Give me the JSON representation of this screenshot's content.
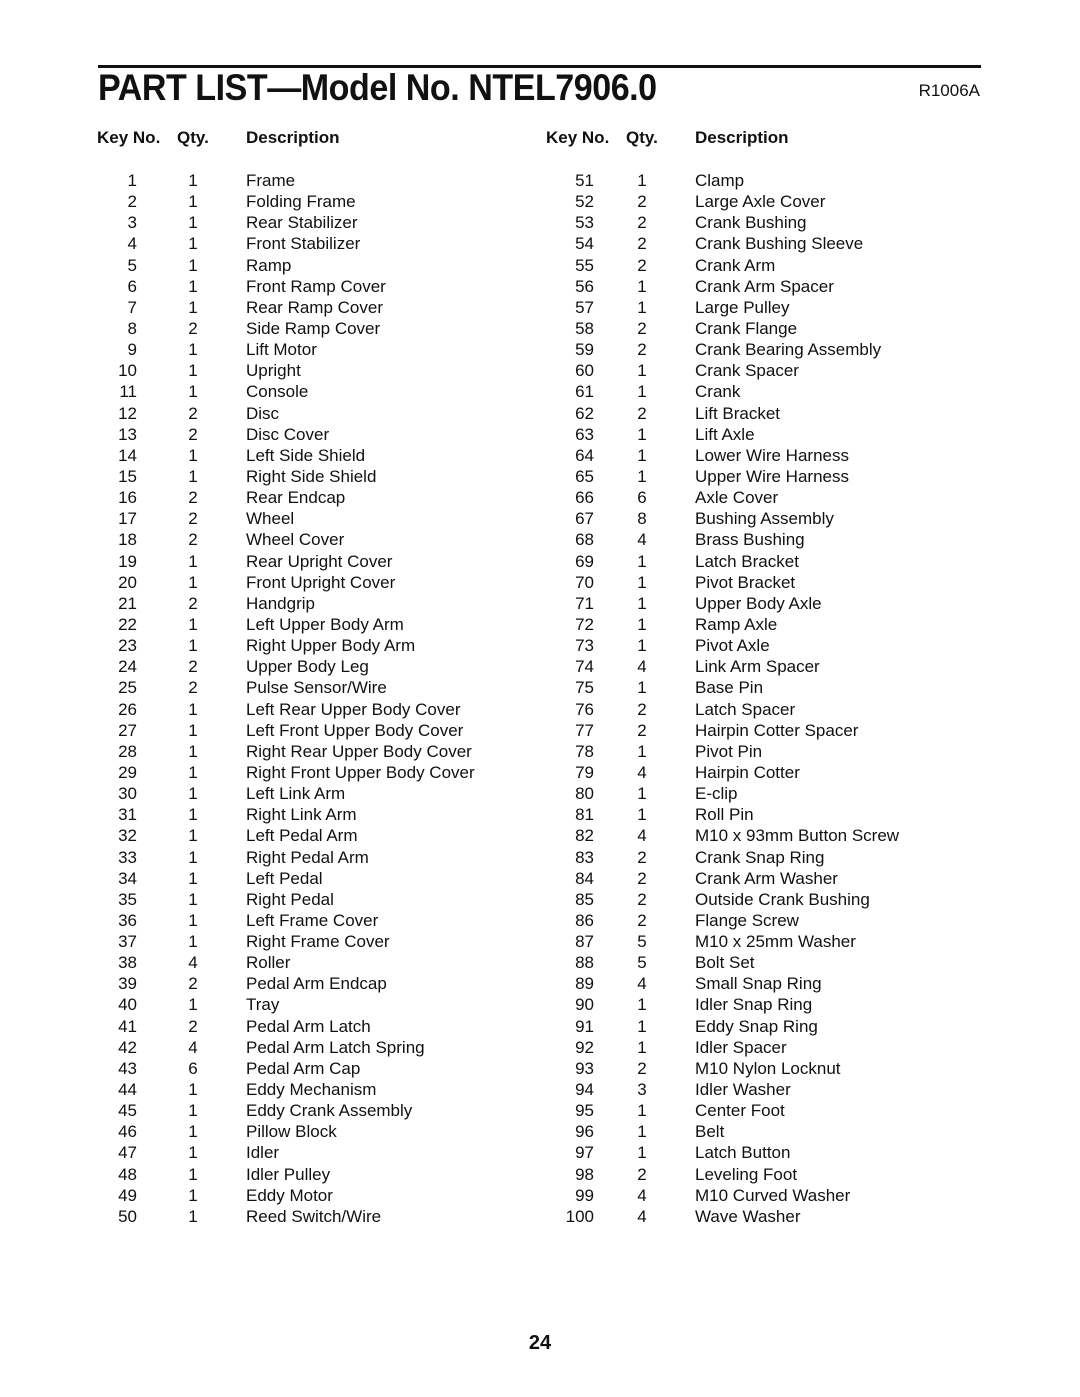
{
  "header": {
    "title": "PART LIST—Model No. NTEL7906.0",
    "code": "R1006A"
  },
  "columns": {
    "key_label": "Key No.",
    "qty_label": "Qty.",
    "desc_label": "Description"
  },
  "parts_left": [
    {
      "key": "1",
      "qty": "1",
      "desc": "Frame"
    },
    {
      "key": "2",
      "qty": "1",
      "desc": "Folding Frame"
    },
    {
      "key": "3",
      "qty": "1",
      "desc": "Rear Stabilizer"
    },
    {
      "key": "4",
      "qty": "1",
      "desc": "Front Stabilizer"
    },
    {
      "key": "5",
      "qty": "1",
      "desc": "Ramp"
    },
    {
      "key": "6",
      "qty": "1",
      "desc": "Front Ramp Cover"
    },
    {
      "key": "7",
      "qty": "1",
      "desc": "Rear Ramp Cover"
    },
    {
      "key": "8",
      "qty": "2",
      "desc": "Side Ramp Cover"
    },
    {
      "key": "9",
      "qty": "1",
      "desc": "Lift Motor"
    },
    {
      "key": "10",
      "qty": "1",
      "desc": "Upright"
    },
    {
      "key": "11",
      "qty": "1",
      "desc": "Console"
    },
    {
      "key": "12",
      "qty": "2",
      "desc": "Disc"
    },
    {
      "key": "13",
      "qty": "2",
      "desc": "Disc Cover"
    },
    {
      "key": "14",
      "qty": "1",
      "desc": "Left Side Shield"
    },
    {
      "key": "15",
      "qty": "1",
      "desc": "Right Side Shield"
    },
    {
      "key": "16",
      "qty": "2",
      "desc": "Rear Endcap"
    },
    {
      "key": "17",
      "qty": "2",
      "desc": "Wheel"
    },
    {
      "key": "18",
      "qty": "2",
      "desc": "Wheel Cover"
    },
    {
      "key": "19",
      "qty": "1",
      "desc": "Rear Upright Cover"
    },
    {
      "key": "20",
      "qty": "1",
      "desc": "Front Upright Cover"
    },
    {
      "key": "21",
      "qty": "2",
      "desc": "Handgrip"
    },
    {
      "key": "22",
      "qty": "1",
      "desc": "Left Upper Body Arm"
    },
    {
      "key": "23",
      "qty": "1",
      "desc": "Right Upper Body Arm"
    },
    {
      "key": "24",
      "qty": "2",
      "desc": "Upper Body Leg"
    },
    {
      "key": "25",
      "qty": "2",
      "desc": "Pulse Sensor/Wire"
    },
    {
      "key": "26",
      "qty": "1",
      "desc": "Left Rear Upper Body Cover"
    },
    {
      "key": "27",
      "qty": "1",
      "desc": "Left Front Upper Body Cover"
    },
    {
      "key": "28",
      "qty": "1",
      "desc": "Right Rear Upper Body Cover"
    },
    {
      "key": "29",
      "qty": "1",
      "desc": "Right Front Upper Body Cover"
    },
    {
      "key": "30",
      "qty": "1",
      "desc": "Left Link Arm"
    },
    {
      "key": "31",
      "qty": "1",
      "desc": "Right Link Arm"
    },
    {
      "key": "32",
      "qty": "1",
      "desc": "Left Pedal Arm"
    },
    {
      "key": "33",
      "qty": "1",
      "desc": "Right Pedal Arm"
    },
    {
      "key": "34",
      "qty": "1",
      "desc": "Left Pedal"
    },
    {
      "key": "35",
      "qty": "1",
      "desc": "Right Pedal"
    },
    {
      "key": "36",
      "qty": "1",
      "desc": "Left Frame Cover"
    },
    {
      "key": "37",
      "qty": "1",
      "desc": "Right Frame Cover"
    },
    {
      "key": "38",
      "qty": "4",
      "desc": "Roller"
    },
    {
      "key": "39",
      "qty": "2",
      "desc": "Pedal Arm Endcap"
    },
    {
      "key": "40",
      "qty": "1",
      "desc": "Tray"
    },
    {
      "key": "41",
      "qty": "2",
      "desc": "Pedal Arm Latch"
    },
    {
      "key": "42",
      "qty": "4",
      "desc": "Pedal Arm Latch Spring"
    },
    {
      "key": "43",
      "qty": "6",
      "desc": "Pedal Arm Cap"
    },
    {
      "key": "44",
      "qty": "1",
      "desc": "Eddy Mechanism"
    },
    {
      "key": "45",
      "qty": "1",
      "desc": "Eddy Crank Assembly"
    },
    {
      "key": "46",
      "qty": "1",
      "desc": "Pillow Block"
    },
    {
      "key": "47",
      "qty": "1",
      "desc": "Idler"
    },
    {
      "key": "48",
      "qty": "1",
      "desc": "Idler Pulley"
    },
    {
      "key": "49",
      "qty": "1",
      "desc": "Eddy Motor"
    },
    {
      "key": "50",
      "qty": "1",
      "desc": "Reed Switch/Wire"
    }
  ],
  "parts_right": [
    {
      "key": "51",
      "qty": "1",
      "desc": "Clamp"
    },
    {
      "key": "52",
      "qty": "2",
      "desc": "Large Axle Cover"
    },
    {
      "key": "53",
      "qty": "2",
      "desc": "Crank Bushing"
    },
    {
      "key": "54",
      "qty": "2",
      "desc": "Crank Bushing Sleeve"
    },
    {
      "key": "55",
      "qty": "2",
      "desc": "Crank Arm"
    },
    {
      "key": "56",
      "qty": "1",
      "desc": "Crank Arm Spacer"
    },
    {
      "key": "57",
      "qty": "1",
      "desc": "Large Pulley"
    },
    {
      "key": "58",
      "qty": "2",
      "desc": "Crank Flange"
    },
    {
      "key": "59",
      "qty": "2",
      "desc": "Crank Bearing Assembly"
    },
    {
      "key": "60",
      "qty": "1",
      "desc": "Crank Spacer"
    },
    {
      "key": "61",
      "qty": "1",
      "desc": "Crank"
    },
    {
      "key": "62",
      "qty": "2",
      "desc": "Lift Bracket"
    },
    {
      "key": "63",
      "qty": "1",
      "desc": "Lift Axle"
    },
    {
      "key": "64",
      "qty": "1",
      "desc": "Lower Wire Harness"
    },
    {
      "key": "65",
      "qty": "1",
      "desc": "Upper Wire Harness"
    },
    {
      "key": "66",
      "qty": "6",
      "desc": "Axle Cover"
    },
    {
      "key": "67",
      "qty": "8",
      "desc": "Bushing Assembly"
    },
    {
      "key": "68",
      "qty": "4",
      "desc": "Brass Bushing"
    },
    {
      "key": "69",
      "qty": "1",
      "desc": "Latch Bracket"
    },
    {
      "key": "70",
      "qty": "1",
      "desc": "Pivot Bracket"
    },
    {
      "key": "71",
      "qty": "1",
      "desc": "Upper Body Axle"
    },
    {
      "key": "72",
      "qty": "1",
      "desc": "Ramp Axle"
    },
    {
      "key": "73",
      "qty": "1",
      "desc": "Pivot Axle"
    },
    {
      "key": "74",
      "qty": "4",
      "desc": "Link Arm Spacer"
    },
    {
      "key": "75",
      "qty": "1",
      "desc": "Base Pin"
    },
    {
      "key": "76",
      "qty": "2",
      "desc": "Latch Spacer"
    },
    {
      "key": "77",
      "qty": "2",
      "desc": "Hairpin Cotter Spacer"
    },
    {
      "key": "78",
      "qty": "1",
      "desc": "Pivot Pin"
    },
    {
      "key": "79",
      "qty": "4",
      "desc": "Hairpin Cotter"
    },
    {
      "key": "80",
      "qty": "1",
      "desc": "E-clip"
    },
    {
      "key": "81",
      "qty": "1",
      "desc": "Roll Pin"
    },
    {
      "key": "82",
      "qty": "4",
      "desc": "M10 x 93mm Button Screw"
    },
    {
      "key": "83",
      "qty": "2",
      "desc": "Crank Snap Ring"
    },
    {
      "key": "84",
      "qty": "2",
      "desc": "Crank Arm Washer"
    },
    {
      "key": "85",
      "qty": "2",
      "desc": "Outside Crank Bushing"
    },
    {
      "key": "86",
      "qty": "2",
      "desc": "Flange Screw"
    },
    {
      "key": "87",
      "qty": "5",
      "desc": "M10 x 25mm Washer"
    },
    {
      "key": "88",
      "qty": "5",
      "desc": "Bolt Set"
    },
    {
      "key": "89",
      "qty": "4",
      "desc": "Small Snap Ring"
    },
    {
      "key": "90",
      "qty": "1",
      "desc": "Idler Snap Ring"
    },
    {
      "key": "91",
      "qty": "1",
      "desc": "Eddy Snap Ring"
    },
    {
      "key": "92",
      "qty": "1",
      "desc": "Idler Spacer"
    },
    {
      "key": "93",
      "qty": "2",
      "desc": "M10 Nylon Locknut"
    },
    {
      "key": "94",
      "qty": "3",
      "desc": "Idler Washer"
    },
    {
      "key": "95",
      "qty": "1",
      "desc": "Center Foot"
    },
    {
      "key": "96",
      "qty": "1",
      "desc": "Belt"
    },
    {
      "key": "97",
      "qty": "1",
      "desc": "Latch Button"
    },
    {
      "key": "98",
      "qty": "2",
      "desc": "Leveling Foot"
    },
    {
      "key": "99",
      "qty": "4",
      "desc": "M10 Curved Washer"
    },
    {
      "key": "100",
      "qty": "4",
      "desc": "Wave Washer"
    }
  ],
  "footer": {
    "page_number": "24"
  }
}
